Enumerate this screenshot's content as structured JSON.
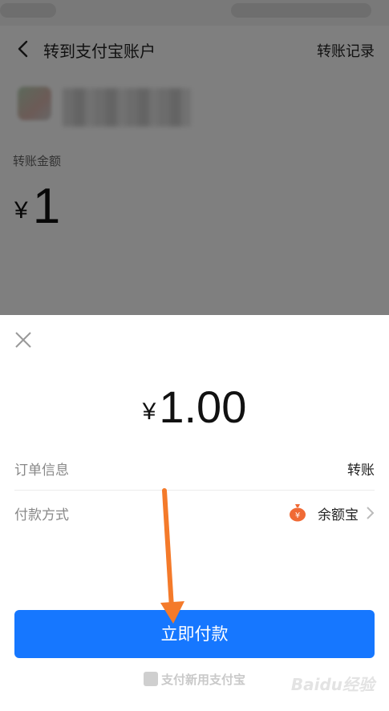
{
  "nav": {
    "title": "转到支付宝账户",
    "right_link": "转账记录"
  },
  "background": {
    "amount_label": "转账金额",
    "currency": "¥",
    "amount": "1"
  },
  "sheet": {
    "currency": "¥",
    "amount": "1.00",
    "rows": [
      {
        "label": "订单信息",
        "value": "转账"
      },
      {
        "label": "付款方式",
        "value": "余额宝",
        "icon": "yuebao-icon"
      }
    ],
    "pay_button": "立即付款",
    "footer_brand": "支付新用支付宝"
  },
  "watermark": "Baidu经验",
  "colors": {
    "primary": "#1677ff",
    "method_icon": "#f06a35",
    "annotation_arrow": "#f47a2a"
  }
}
